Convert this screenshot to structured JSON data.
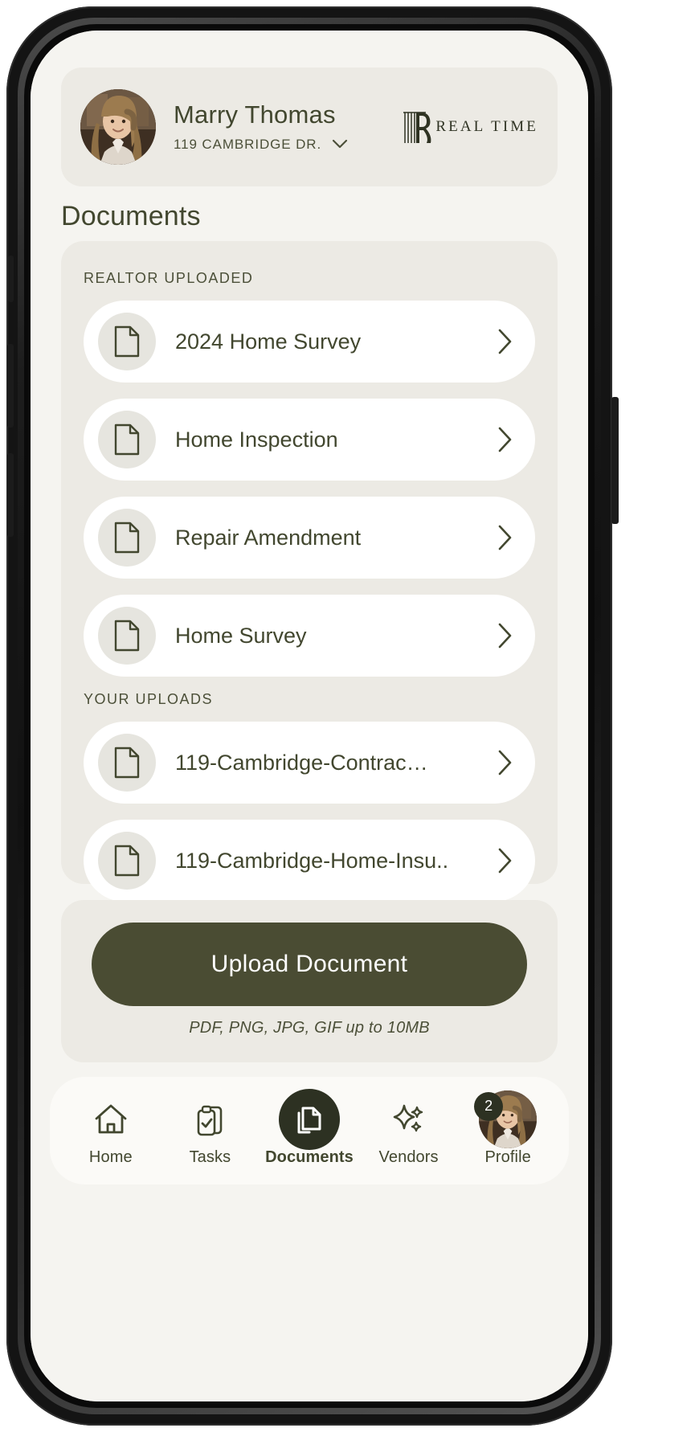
{
  "header": {
    "user_name": "Marry Thomas",
    "address": "119 CAMBRIDGE DR.",
    "address_chevron_icon": "chevron-down-icon",
    "avatar_icon": "user-avatar",
    "brand_mark_icon": "realtime-monogram-icon",
    "brand_text": "REAL TIME"
  },
  "page": {
    "title": "Documents"
  },
  "documents": {
    "realtor_section_label": "REALTOR UPLOADED",
    "realtor_items": [
      {
        "title": "2024 Home Survey",
        "icon": "document-icon",
        "chevron": "chevron-right-icon"
      },
      {
        "title": "Home Inspection",
        "icon": "document-icon",
        "chevron": "chevron-right-icon"
      },
      {
        "title": "Repair Amendment",
        "icon": "document-icon",
        "chevron": "chevron-right-icon"
      },
      {
        "title": "Home Survey",
        "icon": "document-icon",
        "chevron": "chevron-right-icon"
      }
    ],
    "your_section_label": "YOUR UPLOADS",
    "your_items": [
      {
        "title": "119-Cambridge-Contrac…",
        "icon": "document-icon",
        "chevron": "chevron-right-icon"
      },
      {
        "title": "119-Cambridge-Home-Insu..",
        "icon": "document-icon",
        "chevron": "chevron-right-icon"
      }
    ]
  },
  "upload": {
    "button_label": "Upload Document",
    "hint": "PDF, PNG, JPG, GIF up to 10MB"
  },
  "tabbar": {
    "items": [
      {
        "label": "Home",
        "icon": "home-icon",
        "active": false
      },
      {
        "label": "Tasks",
        "icon": "clipboard-check-icon",
        "active": false
      },
      {
        "label": "Documents",
        "icon": "documents-copy-icon",
        "active": true
      },
      {
        "label": "Vendors",
        "icon": "sparkles-icon",
        "active": false
      },
      {
        "label": "Profile",
        "icon": "profile-avatar-icon",
        "active": false,
        "badge": "2"
      }
    ]
  },
  "colors": {
    "brand_dark": "#4a4c33",
    "accent_deep": "#2d3122",
    "screen_bg": "#f5f4f0",
    "panel_bg": "#eceae4",
    "card_white": "#ffffff",
    "text_olive": "#42472f"
  }
}
